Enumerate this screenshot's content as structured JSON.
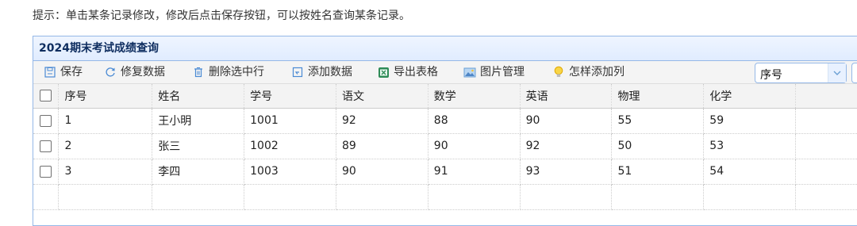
{
  "hint": "提示：单击某条记录修改，修改后点击保存按钮，可以按姓名查询某条记录。",
  "panel": {
    "title": "2024期末考试成绩查询"
  },
  "toolbar": {
    "save": "保存",
    "recover": "修复数据",
    "delete": "删除选中行",
    "add": "添加数据",
    "export": "导出表格",
    "images": "图片管理",
    "howto": "怎样添加列",
    "select_value": "序号"
  },
  "table": {
    "headers": [
      "序号",
      "姓名",
      "学号",
      "语文",
      "数学",
      "英语",
      "物理",
      "化学"
    ],
    "rows": [
      [
        "1",
        "王小明",
        "1001",
        "92",
        "88",
        "90",
        "55",
        "59"
      ],
      [
        "2",
        "张三",
        "1002",
        "89",
        "90",
        "92",
        "50",
        "53"
      ],
      [
        "3",
        "李四",
        "1003",
        "90",
        "91",
        "93",
        "51",
        "54"
      ]
    ]
  },
  "colors": {
    "header_text": "#0e2d5f",
    "border": "#95b8e7"
  }
}
